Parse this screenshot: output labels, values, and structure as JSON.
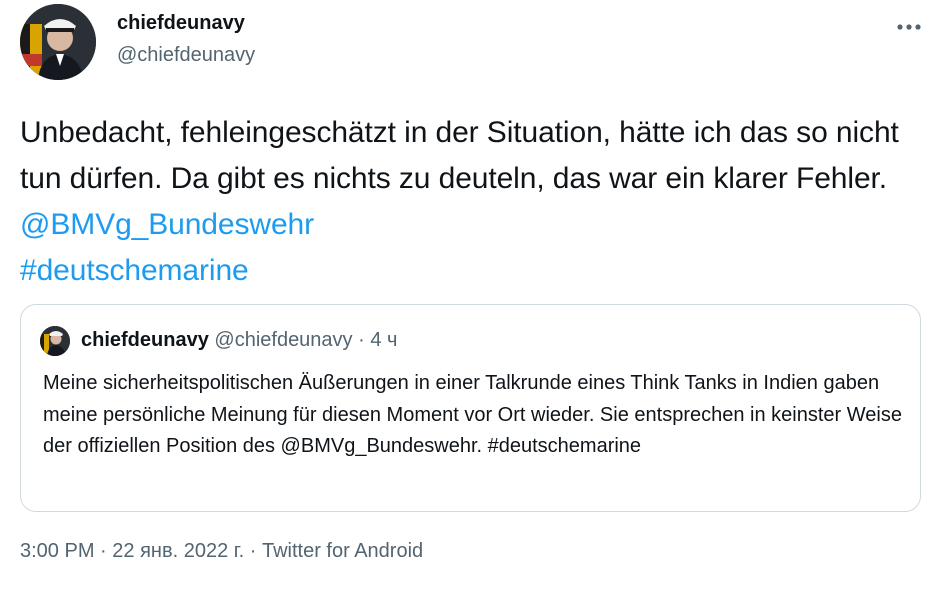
{
  "tweet": {
    "author": {
      "name": "chiefdeunavy",
      "handle": "@chiefdeunavy"
    },
    "text": {
      "main": "Unbedacht, fehleingeschätzt in der Situation, hätte ich das so nicht tun dürfen. Da gibt es nichts zu deuteln, das war ein klarer Fehler.",
      "mention": "@BMVg_Bundeswehr",
      "hashtag": "#deutschemarine"
    },
    "quote": {
      "name": "chiefdeunavy",
      "handle": "@chiefdeunavy",
      "separator": "·",
      "time": "4 ч",
      "text": "Meine sicherheitspolitischen Äußerungen in einer Talkrunde eines Think Tanks in Indien gaben meine persönliche Meinung für diesen Moment vor Ort wieder. Sie entsprechen in keinster Weise der offiziellen Position des @BMVg_Bundeswehr. #deutschemarine"
    },
    "footer": {
      "time": "3:00 PM",
      "sep1": "·",
      "date": "22 янв. 2022 г.",
      "sep2": "·",
      "source": "Twitter for Android"
    }
  },
  "icons": {
    "more": "more-horizontal-icon"
  },
  "colors": {
    "link": "#1d9bf0",
    "text": "#0f1419",
    "secondary": "#536471",
    "border": "#cfd9de"
  }
}
